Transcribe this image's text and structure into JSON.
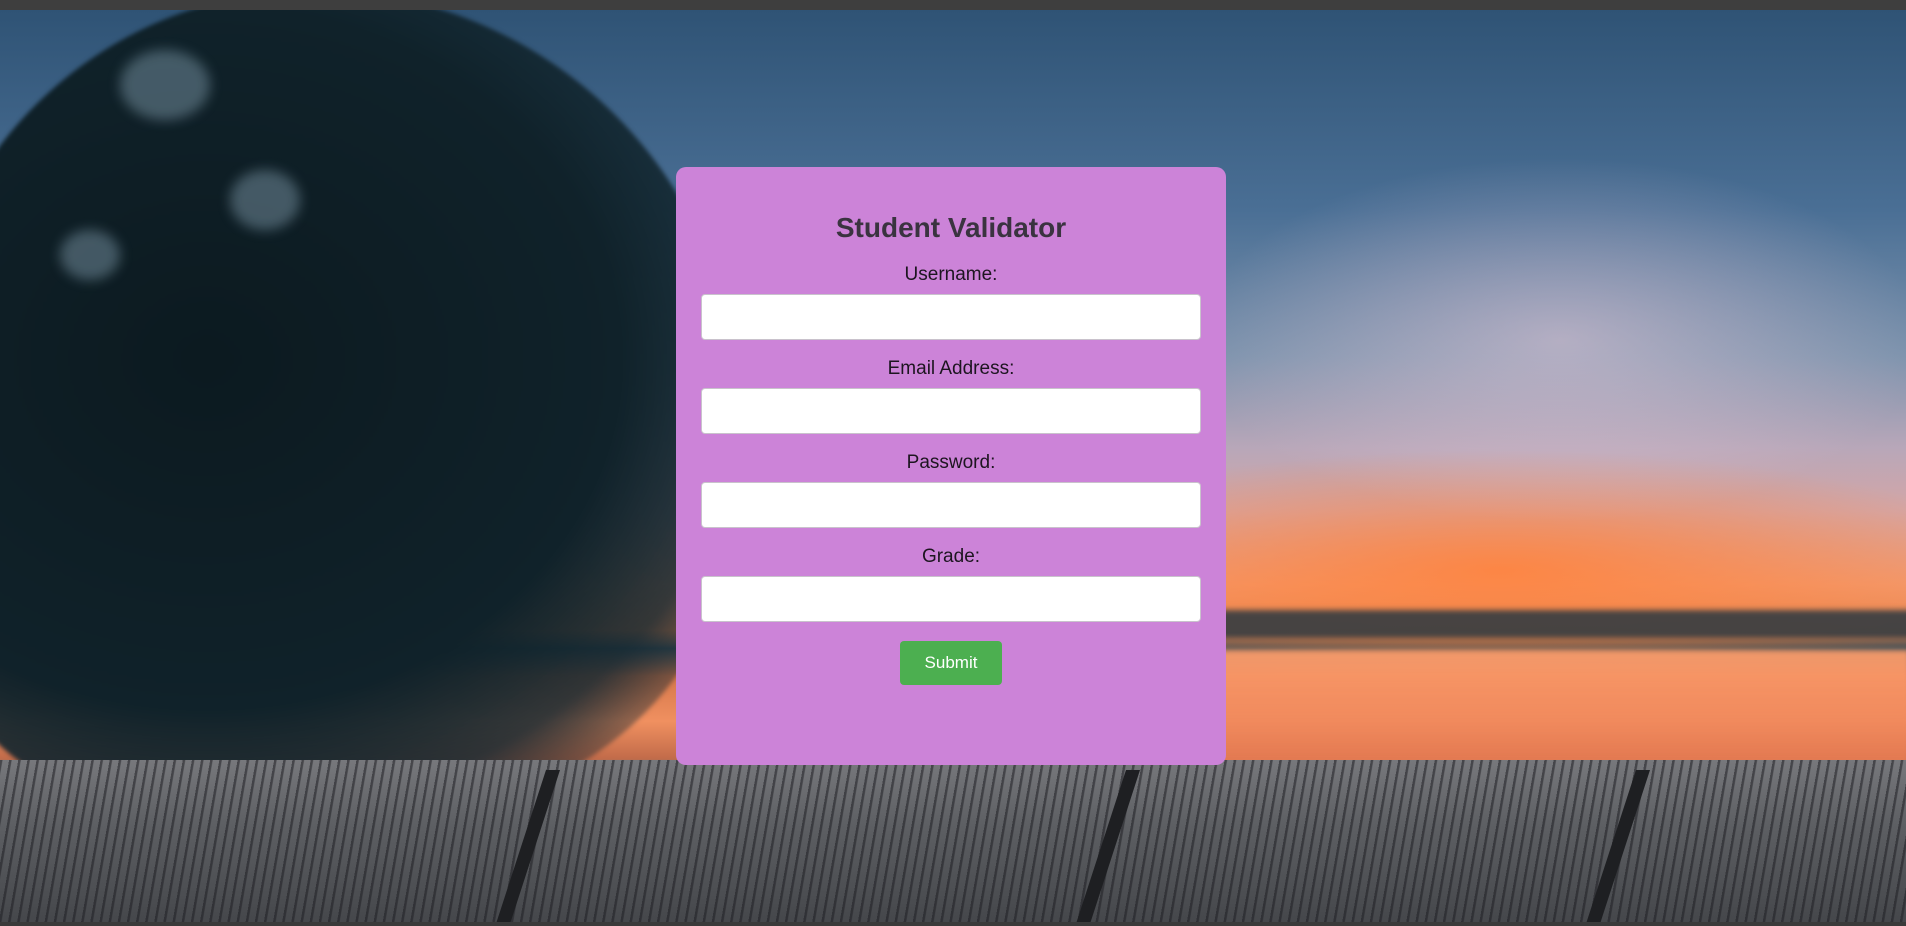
{
  "form": {
    "title": "Student Validator",
    "fields": [
      {
        "label": "Username:",
        "value": "",
        "placeholder": ""
      },
      {
        "label": "Email Address:",
        "value": "",
        "placeholder": ""
      },
      {
        "label": "Password:",
        "value": "",
        "placeholder": ""
      },
      {
        "label": "Grade:",
        "value": "",
        "placeholder": ""
      }
    ],
    "submit_label": "Submit"
  },
  "colors": {
    "card_background": "#cc83d8",
    "submit_button": "#4caf50",
    "title_text": "#3a3340"
  }
}
